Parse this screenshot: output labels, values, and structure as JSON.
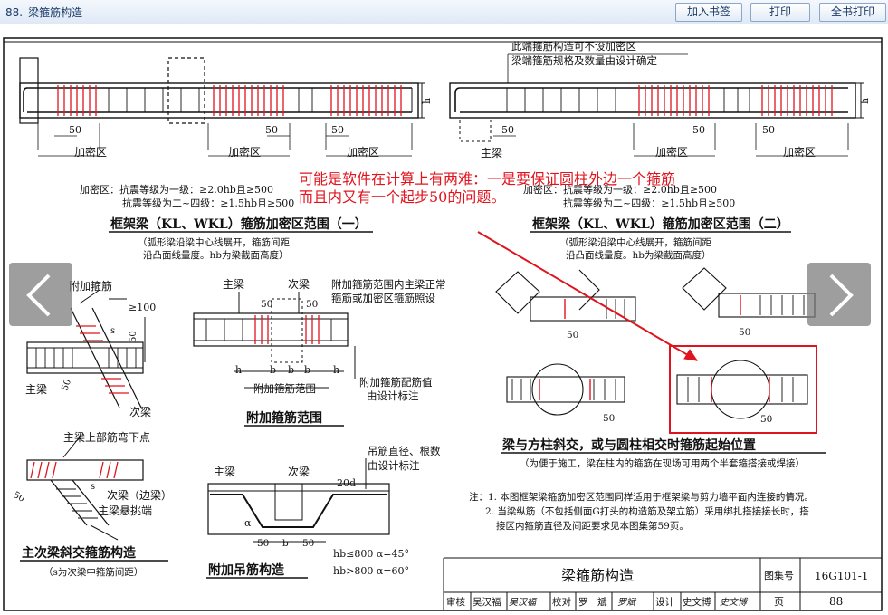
{
  "toolbar": {
    "page_no": "88.",
    "title": "梁箍筋构造",
    "bookmark_label": "加入书签",
    "print_label": "打印",
    "print_all_label": "全书打印"
  },
  "drawing": {
    "dim_50": "50",
    "dim_100": "≥100",
    "zone_label": "加密区",
    "hb": "h",
    "hb_sub": "b",
    "hb_sub1": "1",
    "p1": {
      "zone_line1": "加密区：抗震等级为一级：≥2.0hb且≥500",
      "zone_line2": "抗震等级为二~四级：≥1.5hb且≥500",
      "title": "框架梁（KL、WKL）箍筋加密区范围（一）",
      "sub1": "（弧形梁沿梁中心线展开，箍筋间距",
      "sub2": "沿凸面线量度。hb为梁截面高度）"
    },
    "p2": {
      "note1": "此端箍筋构造可不设加密区",
      "note2": "梁端箍筋规格及数量由设计确定",
      "main_beam": "主梁",
      "zone_line1": "加密区：抗震等级为一级：≥2.0hb且≥500",
      "zone_line2": "抗震等级为二~四级：≥1.5hb且≥500",
      "title": "框架梁（KL、WKL）箍筋加密区范围（二）",
      "sub1": "（弧形梁沿梁中心线展开，箍筋间距",
      "sub2": "沿凸面线量度。hb为梁截面高度）"
    },
    "p3": {
      "extra_stirrup": "附加箍筋",
      "main_beam": "主梁",
      "secondary_beam": "次梁",
      "s": "s"
    },
    "p4": {
      "main_beam": "主梁",
      "secondary_beam": "次梁",
      "note1": "附加箍筋范围内主梁正常",
      "note2": "箍筋或加密区箍筋照设",
      "note3": "附加箍筋配筋值",
      "note4": "由设计标注",
      "b": "b",
      "h1": "h",
      "range": "附加箍筋范围",
      "title": "附加箍筋范围"
    },
    "p5": {
      "title": "梁与方柱斜交，或与圆柱相交时箍筋起始位置",
      "sub": "（为便于施工，梁在柱内的箍筋在现场可用两个半套箍搭接或焊接）"
    },
    "p6": {
      "top_bend": "主梁上部筋弯下点",
      "secondary_edge": "次梁（边梁）",
      "main_cantilever": "主梁悬挑端",
      "title": "主次梁斜交箍筋构造",
      "sub": "（s为次梁中箍筋间距）"
    },
    "p7": {
      "main_beam": "主梁",
      "secondary_beam": "次梁",
      "note1": "吊筋直径、根数",
      "note2": "由设计标注",
      "d20": "20d",
      "alpha": "α",
      "cond1": "hb≤800   α=45°",
      "cond2": "hb>800   α=60°",
      "title": "附加吊筋构造"
    },
    "notes": {
      "n1": "注：1. 本图框架梁箍筋加密区范围同样适用于框架梁与剪力墙平面内连接的情况。",
      "n2": "2. 当梁纵筋（不包括侧面G打头的构造筋及架立筋）采用绑扎搭接接长时，搭",
      "n3": "接区内箍筋直径及间距要求见本图集第59页。"
    },
    "annotation": {
      "line1": "可能是软件在计算上有两难：一是要保证圆柱外边一个箍筋",
      "line2": "而且内又有一个起步50的问题。"
    },
    "title_block": {
      "name": "梁箍筋构造",
      "atlas_label": "图集号",
      "atlas_no": "16G101-1",
      "page_label": "页",
      "page_no": "88",
      "r1": "审核",
      "r2": "吴汉福",
      "r3": "吴汉福",
      "r4": "校对",
      "r5": "罗",
      "r6": "斌",
      "r7": "罗斌",
      "r8": "设计",
      "r9": "史文博",
      "r10": "史文博"
    }
  },
  "colors": {
    "red": "#e0141e",
    "ink": "#111111",
    "toolbar": "#dfe9f6"
  },
  "icons": {
    "prev": "chevron-left-icon",
    "next": "chevron-right-icon"
  }
}
